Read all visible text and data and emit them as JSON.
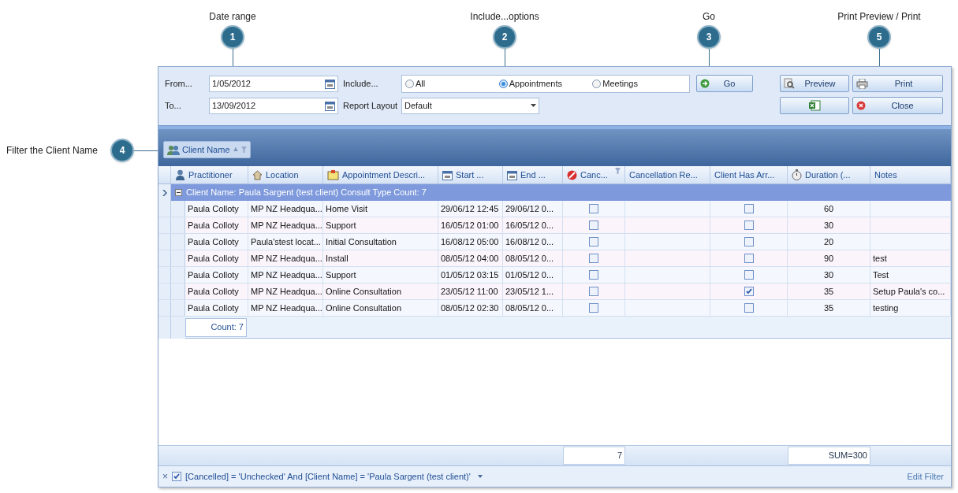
{
  "callouts": [
    {
      "number": "1",
      "label": "Date range"
    },
    {
      "number": "2",
      "label": "Include...options"
    },
    {
      "number": "3",
      "label": "Go"
    },
    {
      "number": "4",
      "label": "Filter the Client Name"
    },
    {
      "number": "5",
      "label": "Print Preview / Print"
    }
  ],
  "filters": {
    "from_label": "From...",
    "from_value": "1/05/2012",
    "to_label": "To...",
    "to_value": "13/09/2012",
    "include_label": "Include...",
    "include_options": [
      {
        "label": "All",
        "selected": false
      },
      {
        "label": "Appointments",
        "selected": true
      },
      {
        "label": "Meetings",
        "selected": false
      }
    ],
    "layout_label": "Report Layout",
    "layout_value": "Default"
  },
  "buttons": {
    "go": "Go",
    "preview": "Preview",
    "print": "Print",
    "close": "Close"
  },
  "group_by": {
    "label": "Client Name",
    "sort": "▲"
  },
  "table": {
    "columns": [
      "Practitioner",
      "Location",
      "Appointment Descri...",
      "Start ...",
      "End ...",
      "Canc...",
      "Cancellation Re...",
      "Client Has Arr...",
      "Duration (...",
      "Notes"
    ],
    "group_row": "Client Name: Paula Sargent (test client) Consult Type Count: 7",
    "rows": [
      {
        "practitioner": "Paula Colloty",
        "location": "MP NZ Headqua...",
        "description": "Home Visit",
        "start": "29/06/12 12:45",
        "end": "29/06/12 0...",
        "cancelled": false,
        "reason": "",
        "arrived": false,
        "duration": "60",
        "notes": ""
      },
      {
        "practitioner": "Paula Colloty",
        "location": "MP NZ Headqua...",
        "description": "Support",
        "start": "16/05/12 01:00",
        "end": "16/05/12 0...",
        "cancelled": false,
        "reason": "",
        "arrived": false,
        "duration": "30",
        "notes": ""
      },
      {
        "practitioner": "Paula Colloty",
        "location": "Paula'stest locat...",
        "description": "Initial Consultation",
        "start": "16/08/12 05:00",
        "end": "16/08/12 0...",
        "cancelled": false,
        "reason": "",
        "arrived": false,
        "duration": "20",
        "notes": ""
      },
      {
        "practitioner": "Paula Colloty",
        "location": "MP NZ Headqua...",
        "description": "Install",
        "start": "08/05/12 04:00",
        "end": "08/05/12 0...",
        "cancelled": false,
        "reason": "",
        "arrived": false,
        "duration": "90",
        "notes": "test"
      },
      {
        "practitioner": "Paula Colloty",
        "location": "MP NZ Headqua...",
        "description": "Support",
        "start": "01/05/12 03:15",
        "end": "01/05/12 0...",
        "cancelled": false,
        "reason": "",
        "arrived": false,
        "duration": "30",
        "notes": "Test"
      },
      {
        "practitioner": "Paula Colloty",
        "location": "MP NZ Headqua...",
        "description": "Online Consultation",
        "start": "23/05/12 11:00",
        "end": "23/05/12 1...",
        "cancelled": false,
        "reason": "",
        "arrived": true,
        "duration": "35",
        "notes": "Setup Paula's co..."
      },
      {
        "practitioner": "Paula Colloty",
        "location": "MP NZ Headqua...",
        "description": "Online Consultation",
        "start": "08/05/12 02:30",
        "end": "08/05/12 0...",
        "cancelled": false,
        "reason": "",
        "arrived": false,
        "duration": "35",
        "notes": "testing"
      }
    ],
    "group_footer": "Count: 7",
    "summary": {
      "cancelled": "7",
      "duration": "SUM=300"
    }
  },
  "filter_bar": {
    "close": "×",
    "enabled": true,
    "expression": "[Cancelled] = 'Unchecked' And [Client Name] = 'Paula Sargent (test client)'",
    "edit": "Edit Filter"
  }
}
